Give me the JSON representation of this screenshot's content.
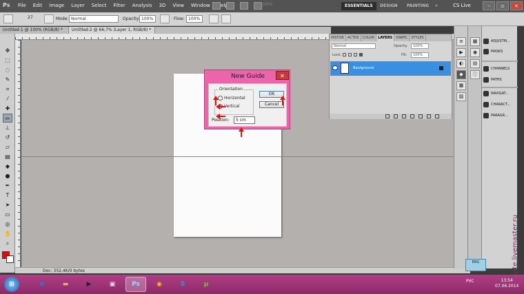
{
  "app": {
    "logo": "Ps",
    "menu": [
      "File",
      "Edit",
      "Image",
      "Layer",
      "Select",
      "Filter",
      "Analysis",
      "3D",
      "View",
      "Window",
      "Help"
    ],
    "zoom": "100%",
    "workspaces": [
      "ESSENTIALS",
      "DESIGN",
      "PAINTING"
    ],
    "more": "»",
    "cs_live": "CS Live"
  },
  "options_bar": {
    "brush_size": "27",
    "mode_label": "Mode:",
    "mode_value": "Normal",
    "opacity_label": "Opacity:",
    "opacity_value": "100%",
    "flow_label": "Flow:",
    "flow_value": "100%"
  },
  "doc_tabs": [
    {
      "label": "Untitled-1 @ 100% (RGB/8) *"
    },
    {
      "label": "Untitled-2 @ 66,7% (Layer 1, RGB/8) *"
    }
  ],
  "status": {
    "doc": "Doc: 352,4K/0 bytes"
  },
  "dialog": {
    "title": "New Guide",
    "orientation_label": "Orientation",
    "horizontal": "Horizontal",
    "vertical": "Vertical",
    "selected": "vertical",
    "ok": "OK",
    "cancel": "Cancel",
    "position_label": "Position:",
    "position_value": "5 cm"
  },
  "layers_panel": {
    "tabs": [
      "HISTOR",
      "ACTIOI",
      "COLOR",
      "LAYERS",
      "SWATC",
      "STYLES"
    ],
    "active_tab": "LAYERS",
    "blend": "Normal",
    "opacity_label": "Opacity:",
    "opacity_value": "100%",
    "lock_label": "Lock:",
    "fill_label": "Fill:",
    "fill_value": "100%",
    "layer_name": "Background"
  },
  "dock": {
    "items": [
      {
        "label": "ADJUSTM...",
        "icon": "adjustments-icon"
      },
      {
        "label": "MASKS",
        "icon": "masks-icon"
      },
      {
        "label": "CHANNELS",
        "icon": "channels-icon"
      },
      {
        "label": "PATHS",
        "icon": "paths-icon"
      },
      {
        "label": "NAVIGAT...",
        "icon": "navigator-icon"
      },
      {
        "label": "CHARACT...",
        "icon": "character-icon"
      },
      {
        "label": "PARAGR...",
        "icon": "paragraph-icon"
      }
    ]
  },
  "badge": {
    "label": "ENG"
  },
  "watermark": "art-kote.livemaster.ru",
  "taskbar": {
    "lang": "РУС",
    "time": "13:54",
    "date": "07.06.2014",
    "apps": [
      {
        "name": "ie",
        "glyph": "e",
        "color": "#1f7fd6"
      },
      {
        "name": "folder",
        "glyph": "▬",
        "color": "#e2b84b"
      },
      {
        "name": "media",
        "glyph": "▶",
        "color": "#3b3b3b"
      },
      {
        "name": "presentation",
        "glyph": "▣",
        "color": "#a23c7d"
      },
      {
        "name": "photoshop",
        "glyph": "Ps",
        "color": "#0c2a4a"
      },
      {
        "name": "chrome",
        "glyph": "◉",
        "color": "#d94b2b"
      },
      {
        "name": "skype",
        "glyph": "S",
        "color": "#19a3e0"
      },
      {
        "name": "utorrent",
        "glyph": "µ",
        "color": "#5fa232"
      }
    ]
  },
  "colors": {
    "foreground": "#e10b0b",
    "background": "#ffffff",
    "accent": "#3a8fe0",
    "dialog_frame": "#ec64a9",
    "taskbar": "#b13d86"
  }
}
